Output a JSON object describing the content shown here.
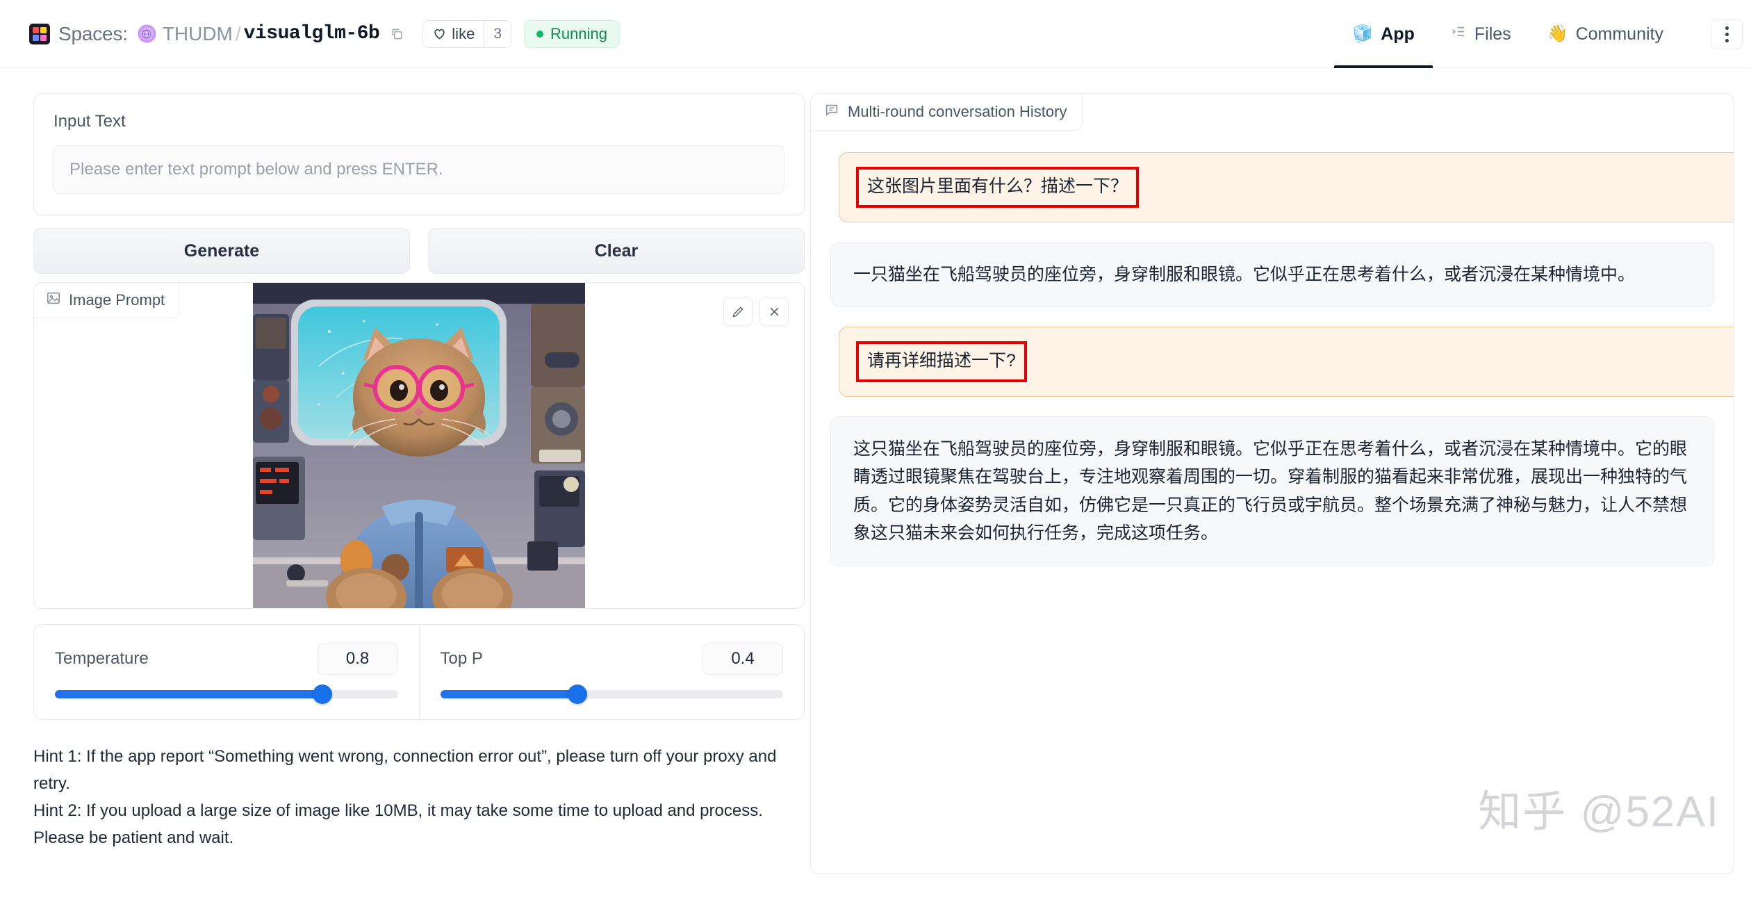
{
  "header": {
    "spaces_label": "Spaces:",
    "org": "THUDM",
    "separator": "/",
    "repo": "visualglm-6b",
    "copy_icon": "copy-icon",
    "like_label": "like",
    "like_count": "3",
    "status": "Running",
    "status_color": "#12b76a",
    "nav": [
      {
        "label": "App",
        "icon": "cube-icon",
        "emoji": "🧊",
        "active": true
      },
      {
        "label": "Files",
        "icon": "files-icon",
        "emoji": "",
        "active": false
      },
      {
        "label": "Community",
        "icon": "wave-icon",
        "emoji": "👋",
        "active": false
      }
    ],
    "menu_icon": "kebab-menu-icon"
  },
  "left": {
    "input_label": "Input Text",
    "input_value": "",
    "input_placeholder": "Please enter text prompt below and press ENTER.",
    "generate_label": "Generate",
    "clear_label": "Clear",
    "image_prompt_label": "Image Prompt",
    "edit_icon": "pencil-icon",
    "close_icon": "close-icon",
    "sliders": [
      {
        "label": "Temperature",
        "value": "0.8",
        "percent": 78
      },
      {
        "label": "Top P",
        "value": "0.4",
        "percent": 40
      }
    ],
    "hint1": "Hint 1: If the app report “Something went wrong, connection error out”, please turn off your proxy and retry.",
    "hint2": "Hint 2: If you upload a large size of image like 10MB, it may take some time to upload and process. Please be patient and wait."
  },
  "chat": {
    "title": "Multi-round conversation History",
    "title_icon": "chat-bubble-icon",
    "messages": [
      {
        "role": "user",
        "text": "这张图片里面有什么？描述一下？",
        "highlighted": true
      },
      {
        "role": "bot",
        "text": "一只猫坐在飞船驾驶员的座位旁，身穿制服和眼镜。它似乎正在思考着什么，或者沉浸在某种情境中。",
        "highlighted": false
      },
      {
        "role": "user",
        "text": "请再详细描述一下?",
        "highlighted": true
      },
      {
        "role": "bot",
        "text": "这只猫坐在飞船驾驶员的座位旁，身穿制服和眼镜。它似乎正在思考着什么，或者沉浸在某种情境中。它的眼睛透过眼镜聚焦在驾驶台上，专注地观察着周围的一切。穿着制服的猫看起来非常优雅，展现出一种独特的气质。它的身体姿势灵活自如，仿佛它是一只真正的飞行员或宇航员。整个场景充满了神秘与魅力，让人不禁想象这只猫未来会如何执行任务，完成这项任务。",
        "highlighted": false
      }
    ],
    "watermark": "知乎 @52AI"
  }
}
